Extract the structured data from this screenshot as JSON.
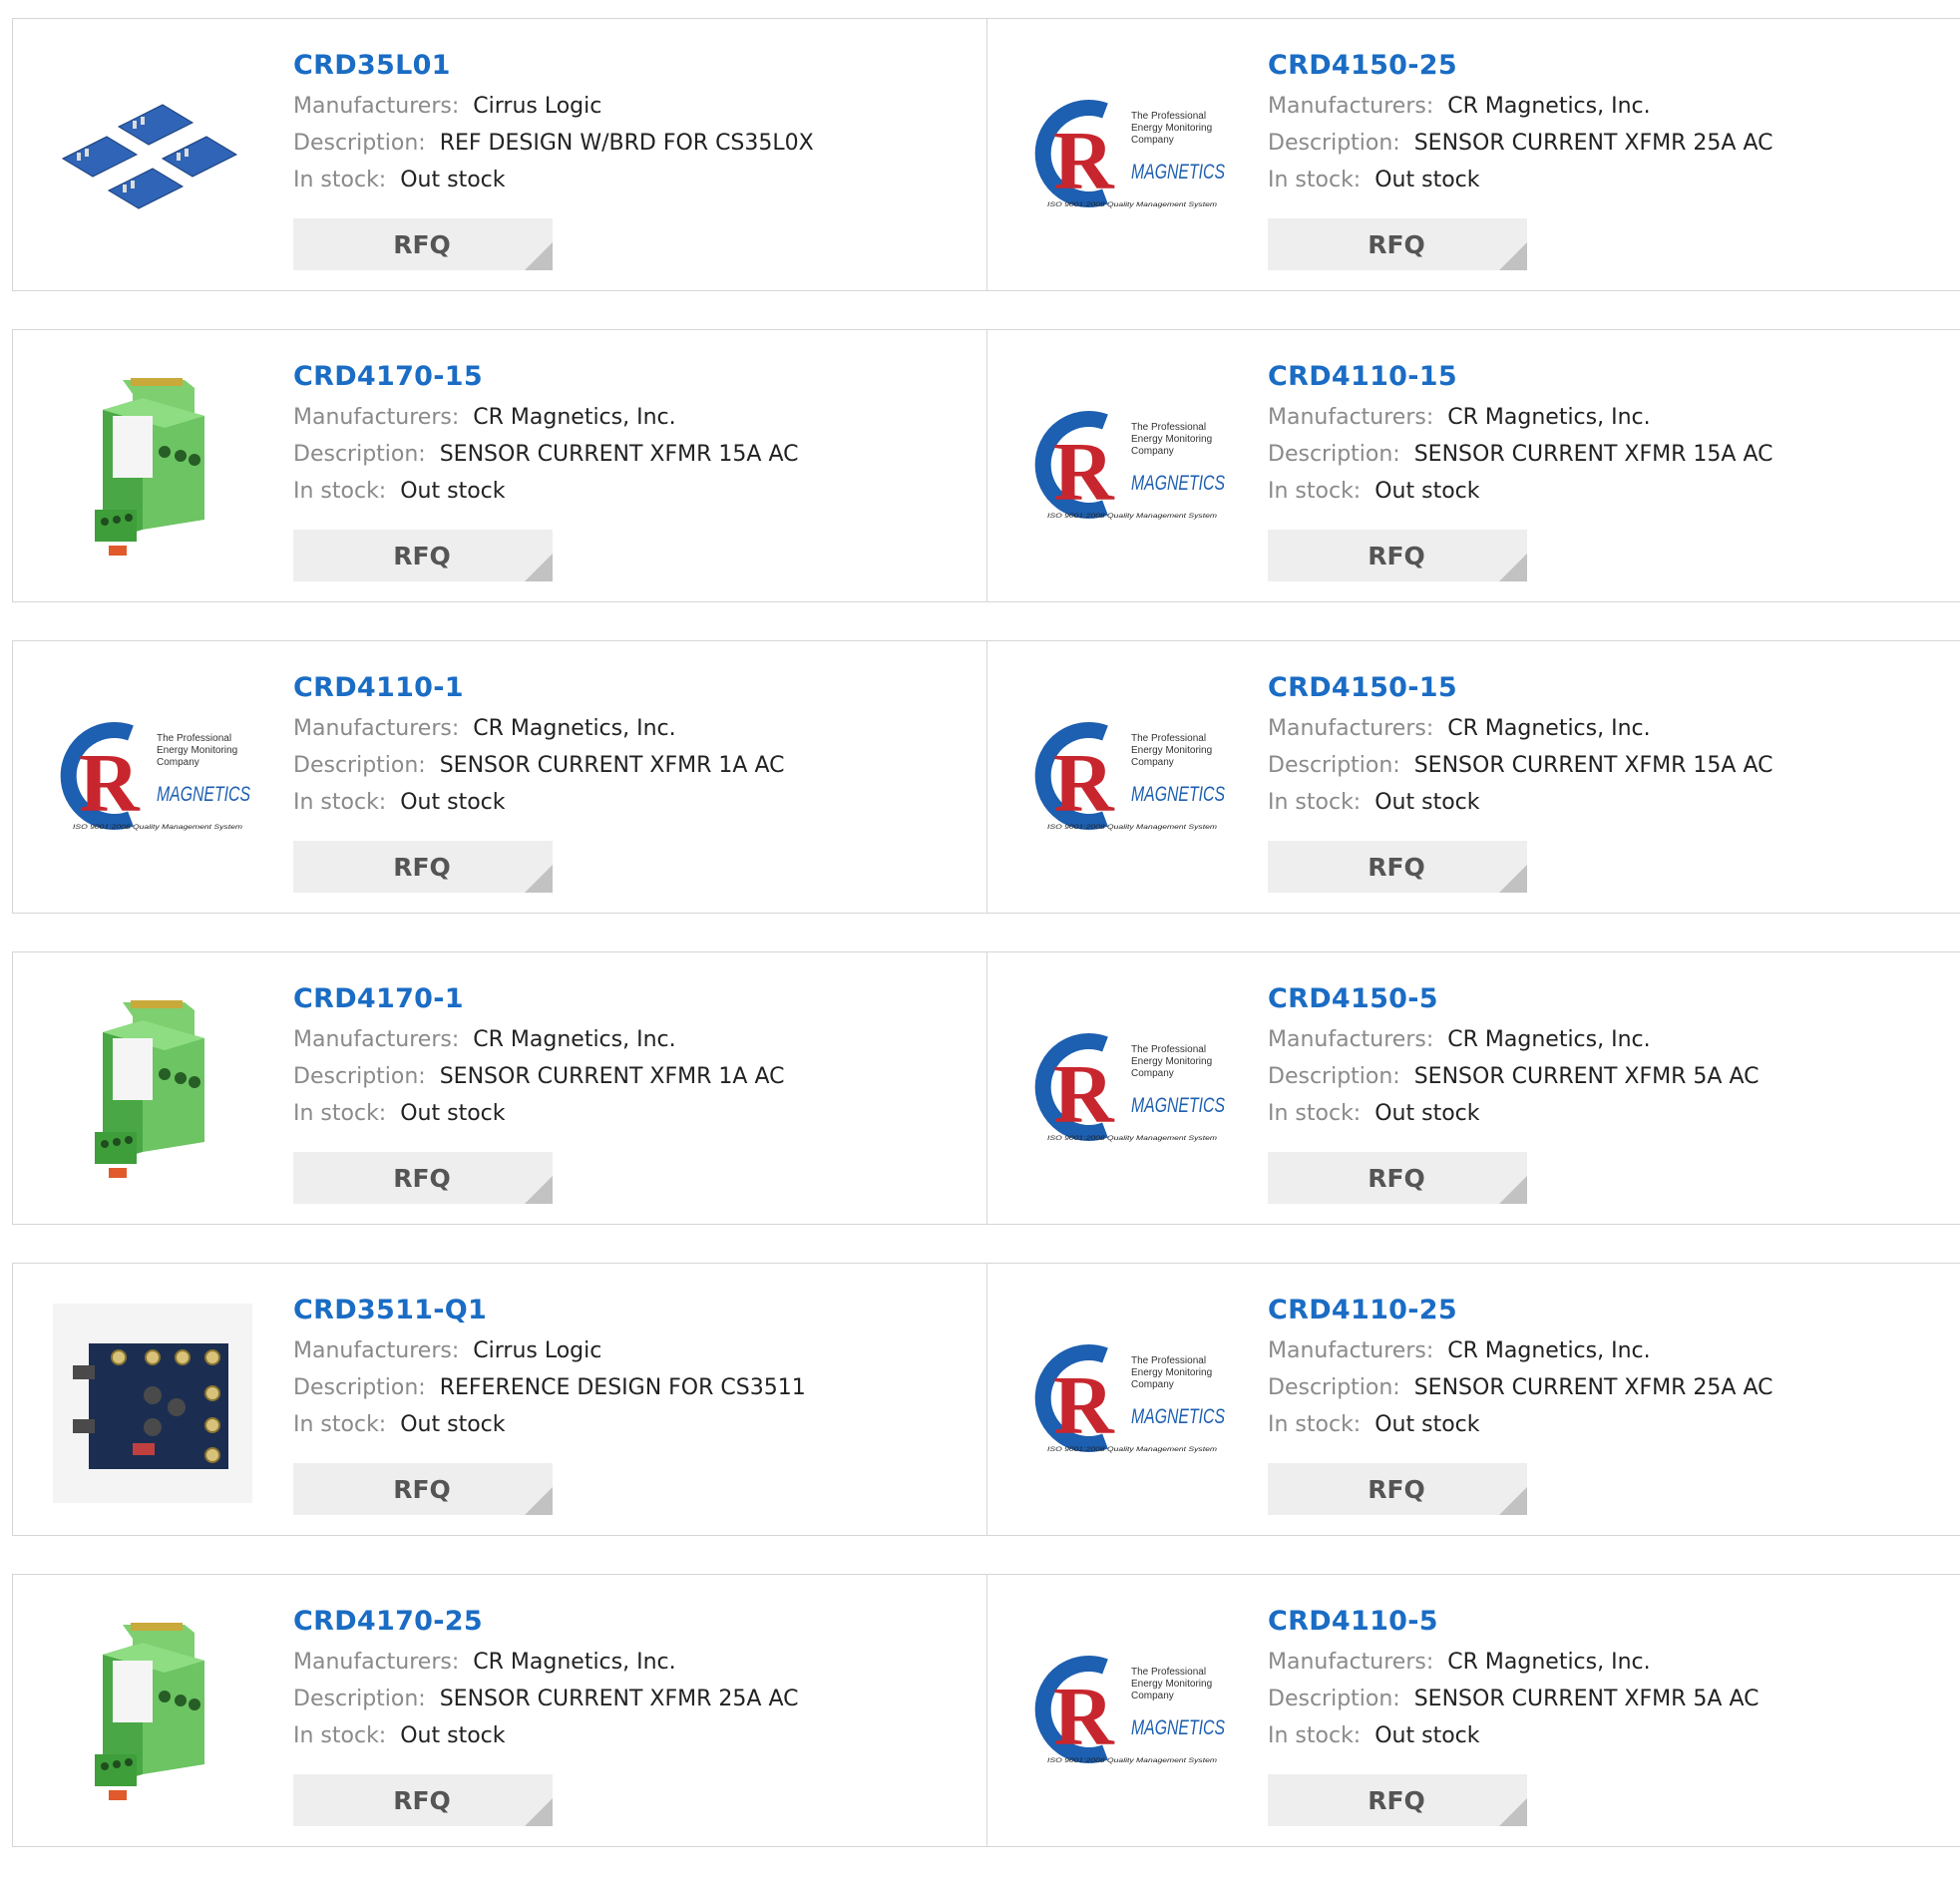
{
  "labels": {
    "manufacturers": "Manufacturers:",
    "description": "Description:",
    "in_stock": "In stock:",
    "rfq": "RFQ"
  },
  "rows": [
    [
      {
        "part": "CRD35L01",
        "manufacturer": "Cirrus Logic",
        "description": "REF DESIGN W/BRD FOR CS35L0X",
        "stock": "Out stock",
        "image": "pcb-boards-image"
      },
      {
        "part": "CRD4150-25",
        "manufacturer": "CR Magnetics, Inc.",
        "description": "SENSOR CURRENT XFMR 25A AC",
        "stock": "Out stock",
        "image": "cr-magnetics-logo"
      }
    ],
    [
      {
        "part": "CRD4170-15",
        "manufacturer": "CR Magnetics, Inc.",
        "description": "SENSOR CURRENT XFMR 15A AC",
        "stock": "Out stock",
        "image": "green-sensor-image"
      },
      {
        "part": "CRD4110-15",
        "manufacturer": "CR Magnetics, Inc.",
        "description": "SENSOR CURRENT XFMR 15A AC",
        "stock": "Out stock",
        "image": "cr-magnetics-logo"
      }
    ],
    [
      {
        "part": "CRD4110-1",
        "manufacturer": "CR Magnetics, Inc.",
        "description": "SENSOR CURRENT XFMR 1A AC",
        "stock": "Out stock",
        "image": "cr-magnetics-logo"
      },
      {
        "part": "CRD4150-15",
        "manufacturer": "CR Magnetics, Inc.",
        "description": "SENSOR CURRENT XFMR 15A AC",
        "stock": "Out stock",
        "image": "cr-magnetics-logo"
      }
    ],
    [
      {
        "part": "CRD4170-1",
        "manufacturer": "CR Magnetics, Inc.",
        "description": "SENSOR CURRENT XFMR 1A AC",
        "stock": "Out stock",
        "image": "green-sensor-image"
      },
      {
        "part": "CRD4150-5",
        "manufacturer": "CR Magnetics, Inc.",
        "description": "SENSOR CURRENT XFMR 5A AC",
        "stock": "Out stock",
        "image": "cr-magnetics-logo"
      }
    ],
    [
      {
        "part": "CRD3511-Q1",
        "manufacturer": "Cirrus Logic",
        "description": "REFERENCE DESIGN FOR CS3511",
        "stock": "Out stock",
        "image": "dark-pcb-image"
      },
      {
        "part": "CRD4110-25",
        "manufacturer": "CR Magnetics, Inc.",
        "description": "SENSOR CURRENT XFMR 25A AC",
        "stock": "Out stock",
        "image": "cr-magnetics-logo"
      }
    ],
    [
      {
        "part": "CRD4170-25",
        "manufacturer": "CR Magnetics, Inc.",
        "description": "SENSOR CURRENT XFMR 25A AC",
        "stock": "Out stock",
        "image": "green-sensor-image"
      },
      {
        "part": "CRD4110-5",
        "manufacturer": "CR Magnetics, Inc.",
        "description": "SENSOR CURRENT XFMR 5A AC",
        "stock": "Out stock",
        "image": "cr-magnetics-logo"
      }
    ]
  ],
  "logo_text": {
    "tagline1": "The Professional",
    "tagline2": "Energy Monitoring",
    "tagline3": "Company",
    "brand": "MAGNETICS",
    "footer": "ISO 9001:2008 Quality Management System"
  },
  "colors": {
    "title_blue": "#1a6cc4",
    "logo_blue": "#1d5fb0",
    "logo_red": "#c8262e",
    "sensor_green": "#5cb85c",
    "button_bg": "#eeeeee"
  }
}
